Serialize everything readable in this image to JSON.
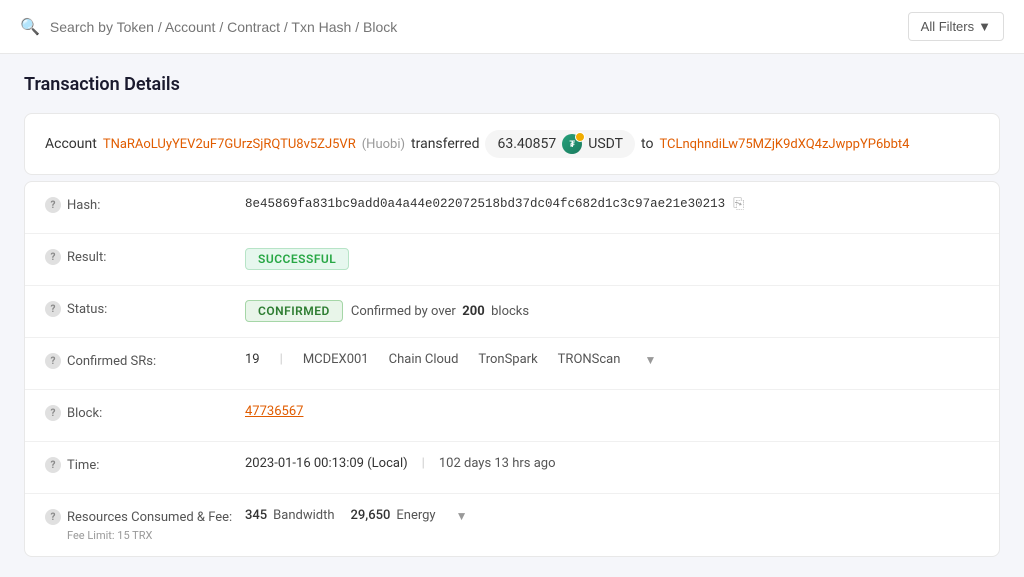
{
  "header": {
    "search_placeholder": "Search by Token / Account / Contract / Txn Hash / Block",
    "filter_label": "All Filters"
  },
  "page": {
    "title": "Transaction Details"
  },
  "transfer": {
    "prefix": "Account",
    "from_account": "TNaRAoLUyYEV2uF7GUrzSjRQTU8v5ZJ5VR",
    "from_label": "(Huobi)",
    "verb": "transferred",
    "amount": "63.40857",
    "token": "USDT",
    "to_word": "to",
    "to_account": "TCLnqhndiLw75MZjK9dXQ4zJwppYP6bbt4"
  },
  "details": {
    "hash_label": "Hash:",
    "hash_value": "8e45869fa831bc9add0a4a44e022072518bd37dc04fc682d1c3c97ae21e30213",
    "result_label": "Result:",
    "result_badge": "SUCCESSFUL",
    "status_label": "Status:",
    "status_badge": "CONFIRMED",
    "status_desc": "Confirmed by over",
    "status_blocks": "200",
    "status_blocks_suffix": "blocks",
    "confirmed_srs_label": "Confirmed SRs:",
    "confirmed_srs_count": "19",
    "sr_names": [
      "MCDEX001",
      "Chain Cloud",
      "TronSpark",
      "TRONScan"
    ],
    "block_label": "Block:",
    "block_value": "47736567",
    "time_label": "Time:",
    "time_local": "2023-01-16 00:13:09 (Local)",
    "time_ago": "102 days 13 hrs ago",
    "resources_label": "Resources Consumed & Fee:",
    "fee_limit": "Fee Limit: 15 TRX",
    "bandwidth_num": "345",
    "bandwidth_label": "Bandwidth",
    "energy_num": "29,650",
    "energy_label": "Energy"
  },
  "icons": {
    "search": "🔍",
    "copy": "⎘",
    "chevron_down": "▼",
    "help": "?"
  }
}
